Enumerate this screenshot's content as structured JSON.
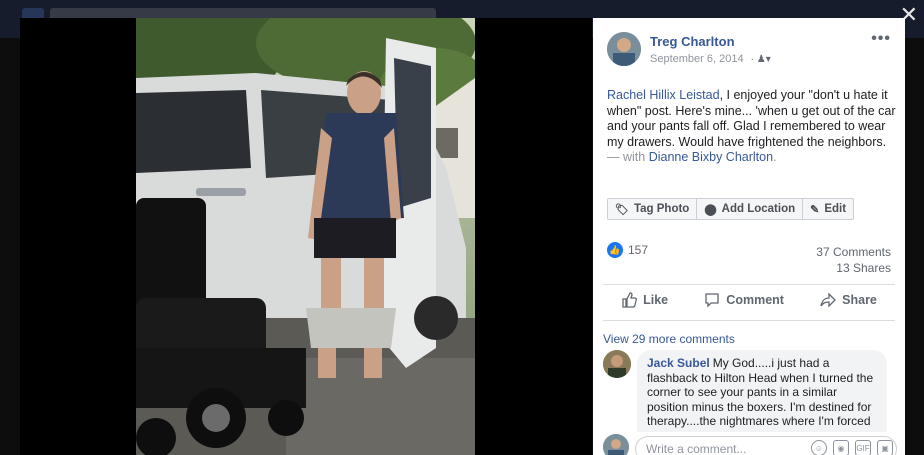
{
  "window": {
    "close_glyph": "✕"
  },
  "post": {
    "author": "Treg Charlton",
    "date": "September 6, 2014",
    "audience_icon": "friends-icon",
    "more_glyph": "•••",
    "text_mention": "Rachel Hillix Leistad",
    "text_body": ", I enjoyed your \"don't u hate it when\" post. Here's mine... 'when u get out of the car and your pants fall off. Glad I remembered to wear my drawers. Would have frightened the neighbors.",
    "text_with_prefix": " — with ",
    "text_with_name": "Dianne Bixby Charlton",
    "text_with_suffix": "."
  },
  "photo_tools": {
    "tag": "Tag Photo",
    "location": "Add Location",
    "edit": "Edit"
  },
  "stats": {
    "reactions": "157",
    "comments": "37 Comments",
    "shares": "13 Shares"
  },
  "actions": {
    "like": "Like",
    "comment": "Comment",
    "share": "Share"
  },
  "comments": {
    "view_more": "View 29 more comments",
    "first": {
      "author": "Jack Subel",
      "text": "My God.....i just had a flashback to Hilton Head when I turned the corner to see your pants in a similar position minus the boxers. I'm destined for therapy....the nightmares where I'm forced"
    },
    "write_placeholder": "Write a comment..."
  },
  "colors": {
    "link": "#385898",
    "like_blue": "#1877f2"
  }
}
